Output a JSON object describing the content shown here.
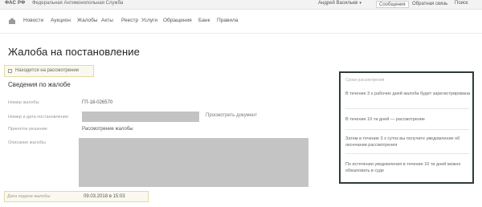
{
  "topbar": {
    "brand": "ФАС РФ",
    "brand_sub": "Федеральная Антимонопольная Служба",
    "user": "Андрей Васильев",
    "user_chevron": "▾",
    "btn1": "Сообщения",
    "btn2": "Обратная связь",
    "search": "Поиск"
  },
  "nav": {
    "items": [
      "Новости",
      "Аукцион",
      "Жалобы",
      "Акты",
      "Реестр",
      "Услуги",
      "Обращения",
      "Банк",
      "Правила"
    ]
  },
  "page": {
    "title": "Жалоба на постановление",
    "status": "Находится на рассмотрении",
    "section": "Сведения по жалобе"
  },
  "details": {
    "number_label": "Номер жалобы",
    "number_value": "ГП-18-026570",
    "doc_label": "Номер и дата постановления",
    "doc_link": "Просмотреть документ",
    "decision_label": "Принятое решение",
    "decision_value": "Рассмотрение жалобы",
    "text_label": "Описание жалобы",
    "date_label": "Дата подачи жалобы",
    "date_value": "09.03.2018 в 15:03"
  },
  "panel": {
    "header": "Сроки рассмотрения",
    "p1": "В течение 3 х рабочих дней жалоба будет зарегистрирована",
    "p2": "В течение 10 ти дней — рассмотрение",
    "p3": "Затем в течение 3 х суток вы получите уведомление об окончании рассмотрения",
    "p4": "По истечении уведомления в течение 10 ти дней можно обжаловать в суде"
  }
}
